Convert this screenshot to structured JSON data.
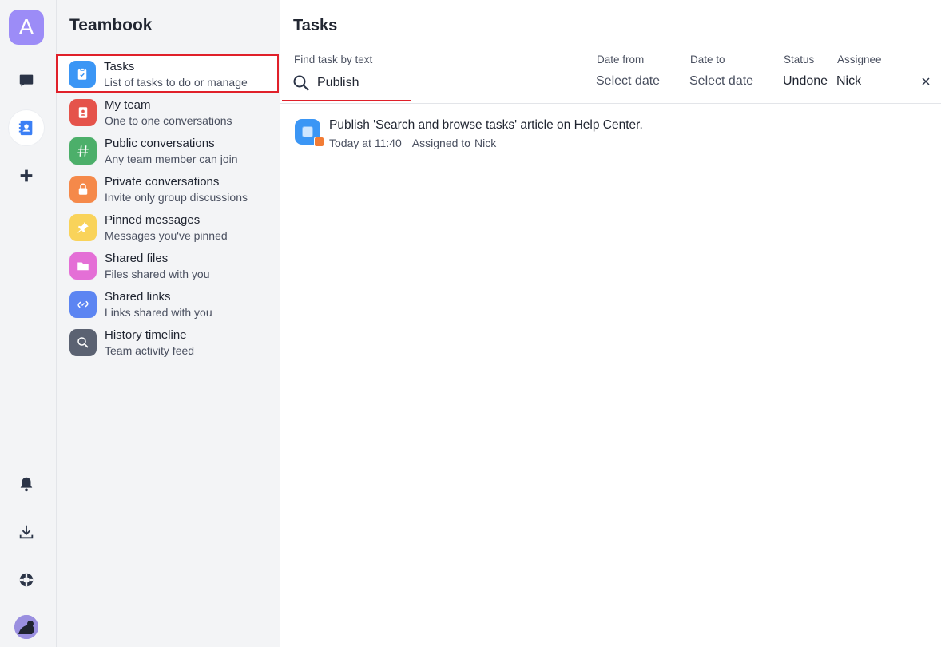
{
  "rail": {
    "workspace_letter": "A",
    "items": [
      {
        "icon": "chat-icon"
      },
      {
        "icon": "contacts-icon"
      },
      {
        "icon": "plus-icon"
      },
      {
        "icon": "bell-icon"
      },
      {
        "icon": "download-icon"
      },
      {
        "icon": "help-lifebuoy-icon"
      }
    ]
  },
  "nav": {
    "title": "Teambook",
    "items": [
      {
        "label": "Tasks",
        "sub": "List of tasks to do or manage",
        "color": "#3b96f5",
        "icon": "clipboard-check-icon"
      },
      {
        "label": "My team",
        "sub": "One to one conversations",
        "color": "#e5534b",
        "icon": "address-book-icon"
      },
      {
        "label": "Public conversations",
        "sub": "Any team member can join",
        "color": "#4caf6a",
        "icon": "hash-icon"
      },
      {
        "label": "Private conversations",
        "sub": "Invite only group discussions",
        "color": "#f5894a",
        "icon": "lock-icon"
      },
      {
        "label": "Pinned messages",
        "sub": "Messages you've pinned",
        "color": "#f9d35a",
        "icon": "pin-icon"
      },
      {
        "label": "Shared files",
        "sub": "Files shared with you",
        "color": "#e46fd6",
        "icon": "folder-icon"
      },
      {
        "label": "Shared links",
        "sub": "Links shared with you",
        "color": "#5c85f2",
        "icon": "link-icon"
      },
      {
        "label": "History timeline",
        "sub": "Team activity feed",
        "color": "#5b6272",
        "icon": "search-icon"
      }
    ]
  },
  "main": {
    "title": "Tasks",
    "filters": {
      "search_label": "Find task by text",
      "search_value": "Publish",
      "date_from_label": "Date from",
      "date_from_value": "Select date",
      "date_to_label": "Date to",
      "date_to_value": "Select date",
      "status_label": "Status",
      "status_value": "Undone",
      "assignee_label": "Assignee",
      "assignee_value": "Nick"
    },
    "tasks": [
      {
        "title": "Publish 'Search and browse tasks' article on Help Center.",
        "time": "Today at 11:40",
        "assigned_label": "Assigned to",
        "assignee": "Nick"
      }
    ]
  }
}
